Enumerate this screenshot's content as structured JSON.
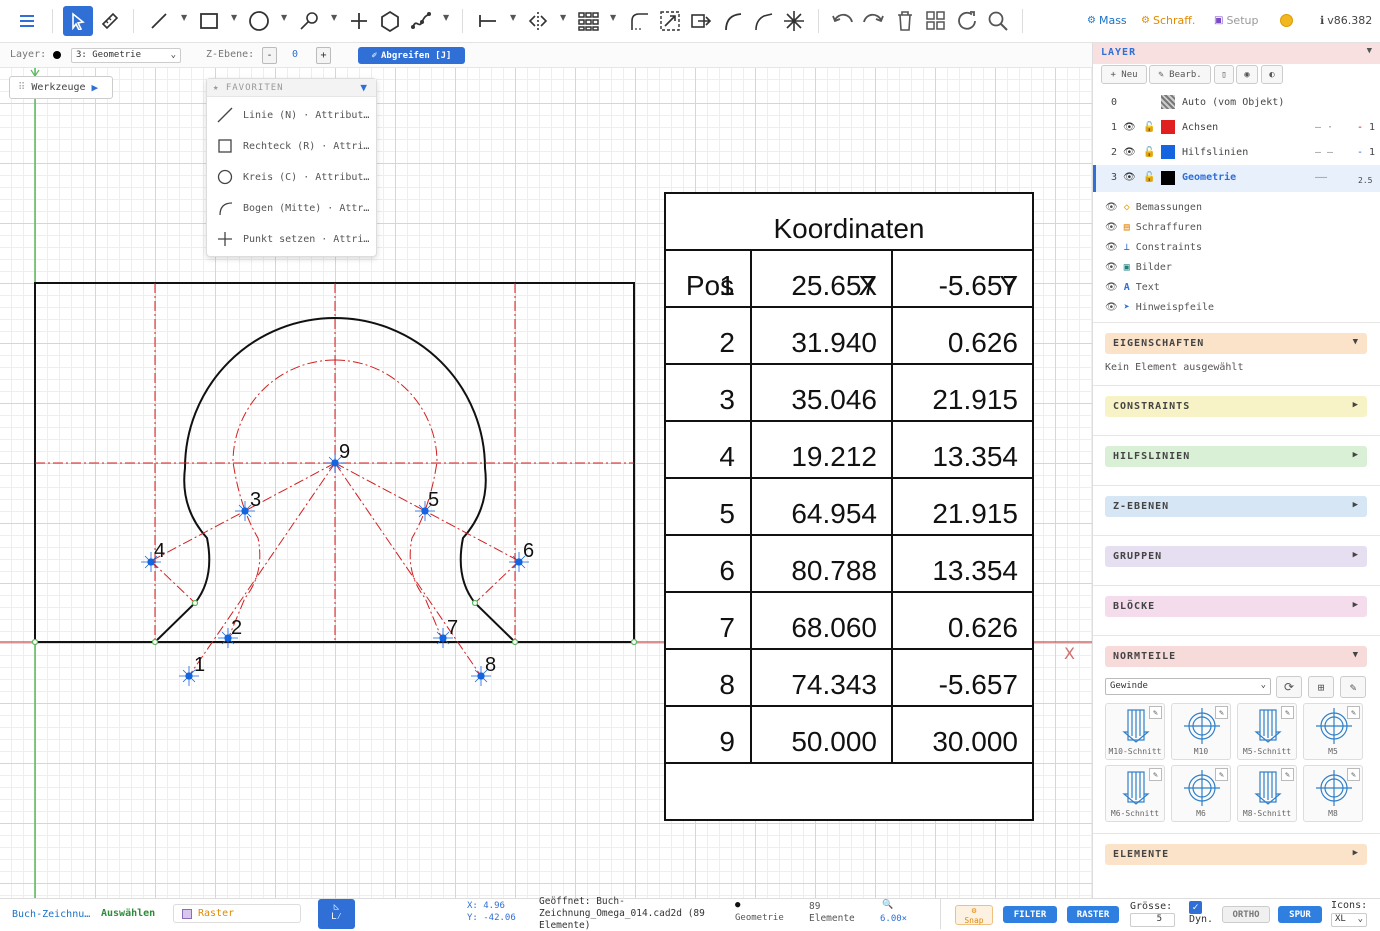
{
  "toolbar": {
    "tools": [
      "menu-icon",
      "select-icon",
      "measure-icon",
      "line-icon",
      "rectangle-icon",
      "circle-icon",
      "polyline-icon",
      "point-icon",
      "polygon-icon",
      "spline-icon",
      "dimension-icon",
      "mirror-icon",
      "array-icon",
      "fillet-icon",
      "scale-icon",
      "move-icon",
      "arc-icon",
      "chamfer-icon",
      "explode-icon",
      "undo-icon",
      "redo-icon",
      "delete-icon",
      "grid-icon",
      "refresh-icon",
      "search-icon"
    ],
    "mass_label": "Mass",
    "schraff_label": "Schraff.",
    "setup_label": "Setup",
    "version": "v86.382",
    "accent": "#2f6fd6"
  },
  "subbar": {
    "layer_label": "Layer:",
    "layer_value": "3: Geometrie",
    "zebene_label": "Z-Ebene:",
    "zebene_minus": "-",
    "zebene_value": "0",
    "zebene_plus": "+",
    "abgreifen_label": "Abgreifen [J]"
  },
  "werkzeuge": {
    "label": "Werkzeuge"
  },
  "favoriten": {
    "title": "★ FAVORITEN",
    "items": [
      {
        "icon": "line-icon",
        "label": "Linie (N) · Attribut…"
      },
      {
        "icon": "rectangle-icon",
        "label": "Rechteck (R) · Attri…"
      },
      {
        "icon": "circle-icon",
        "label": "Kreis (C) · Attribut…"
      },
      {
        "icon": "arc-icon",
        "label": "Bogen (Mitte) · Attr…"
      },
      {
        "icon": "point-icon",
        "label": "Punkt setzen · Attri…"
      }
    ]
  },
  "drawing": {
    "point_labels": [
      "1",
      "2",
      "3",
      "4",
      "5",
      "6",
      "7",
      "8",
      "9"
    ],
    "axis_x_label": "X",
    "table": {
      "title": "Koordinaten",
      "headers": [
        "Pos",
        "X",
        "Y"
      ],
      "rows": [
        [
          "1",
          "25.657",
          "-5.657"
        ],
        [
          "2",
          "31.940",
          "0.626"
        ],
        [
          "3",
          "35.046",
          "21.915"
        ],
        [
          "4",
          "19.212",
          "13.354"
        ],
        [
          "5",
          "64.954",
          "21.915"
        ],
        [
          "6",
          "80.788",
          "13.354"
        ],
        [
          "7",
          "68.060",
          "0.626"
        ],
        [
          "8",
          "74.343",
          "-5.657"
        ],
        [
          "9",
          "50.000",
          "30.000"
        ]
      ]
    }
  },
  "panel": {
    "layer_title": "LAYER",
    "neu_label": "+ Neu",
    "bearb_label": "✎ Bearb.",
    "layers": [
      {
        "num": "0",
        "name": "Auto (vom Objekt)",
        "color": "#999999",
        "width": ""
      },
      {
        "num": "1",
        "name": "Achsen",
        "color": "#e02020",
        "width": "1"
      },
      {
        "num": "2",
        "name": "Hilfslinien",
        "color": "#1565e0",
        "width": "1"
      },
      {
        "num": "3",
        "name": "Geometrie",
        "color": "#000000",
        "width": "2.5"
      }
    ],
    "sublayers": [
      {
        "icon": "◇",
        "label": "Bemassungen"
      },
      {
        "icon": "▤",
        "label": "Schraffuren"
      },
      {
        "icon": "⊥",
        "label": "Constraints"
      },
      {
        "icon": "▣",
        "label": "Bilder"
      },
      {
        "icon": "A",
        "label": "Text"
      },
      {
        "icon": "➤",
        "label": "Hinweispfeile"
      }
    ],
    "eigenschaften_title": "EIGENSCHAFTEN",
    "eigenschaften_text": "Kein Element ausgewählt",
    "constraints_title": "CONSTRAINTS",
    "hilfslinien_title": "HILFSLINIEN",
    "zebenen_title": "Z-EBENEN",
    "gruppen_title": "GRUPPEN",
    "bloecke_title": "BLÖCKE",
    "normteile_title": "NORMTEILE",
    "normteile_select": "Gewinde",
    "normteile": [
      "M10-Schnitt",
      "M10",
      "M5-Schnitt",
      "M5",
      "M6-Schnitt",
      "M6",
      "M8-Schnitt",
      "M8"
    ],
    "elemente_title": "ELEMENTE"
  },
  "status": {
    "file_short": "Buch-Zeichnu…",
    "auswaehlen": "Auswählen",
    "raster_label": "Raster",
    "coord_x": "X: 4.96",
    "coord_y": "Y: -42.06",
    "opened_line1": "Geöffnet: Buch-",
    "opened_line2": "Zeichnung_Omega_014.cad2d (89",
    "opened_line3": "Elemente)",
    "layer_line1": "●",
    "layer_line2": "Geometrie",
    "elements_count": "89",
    "elements_label": "Elemente",
    "zoom": "6.00×",
    "snap": "Snap",
    "filter": "FILTER",
    "raster": "RASTER",
    "groesse_label": "Grösse:",
    "groesse_value": "5",
    "dyn_label": "Dyn.",
    "ortho": "ORTHO",
    "spur": "SPUR",
    "icons_label": "Icons:",
    "icons_value": "XL"
  }
}
